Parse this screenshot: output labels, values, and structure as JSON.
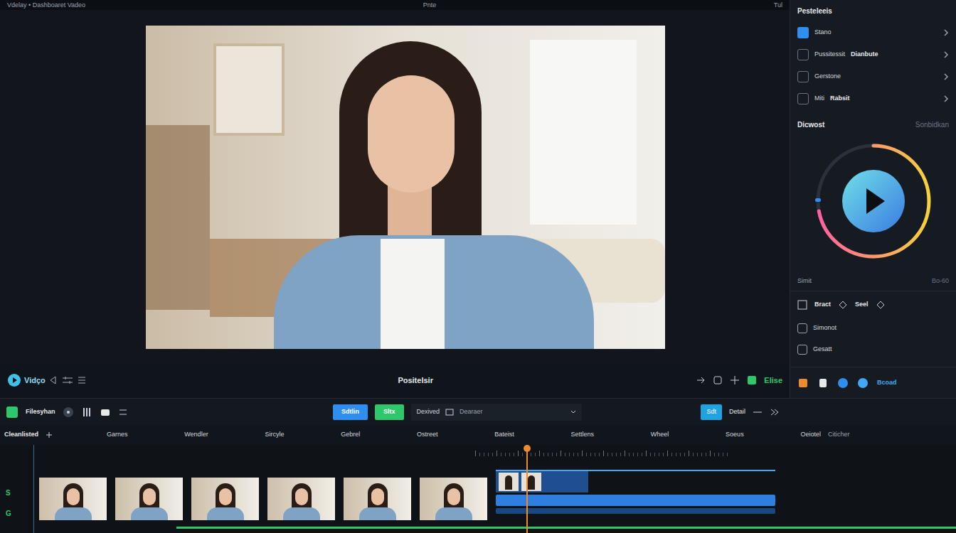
{
  "top_bar": {
    "title": "Vdelay • Dashboaret Vadeo",
    "center": "Pnte",
    "right": "Tul"
  },
  "right_panel": {
    "title": "Pesteleeis",
    "rows": [
      {
        "label": "Stano",
        "value": "",
        "selected": true
      },
      {
        "label": "Pussitessit",
        "value": "Dianbute",
        "selected": false
      },
      {
        "label": "Gerstone",
        "value": "",
        "selected": false
      },
      {
        "label": "Miti",
        "value": "Rabsit",
        "selected": false
      }
    ],
    "section": {
      "title": "Dicwost",
      "action": "Sonbidkan"
    },
    "ring_level": 0.72,
    "under": {
      "label": "Simit",
      "value": "Bo-60"
    },
    "tabs": [
      {
        "label": "Bract"
      },
      {
        "label": "Seel"
      }
    ],
    "options": [
      {
        "label": "Simonot"
      },
      {
        "label": "Gesatt"
      }
    ],
    "footer_action": "Bcoad"
  },
  "preview_bar": {
    "logo": "Vidço",
    "title": "Positelsir",
    "action": "Elise"
  },
  "toolbar": {
    "left": "Filesyhan",
    "buttons": [
      {
        "label": "Sdtlin",
        "color": "#2f8ff0"
      },
      {
        "label": "Sltx",
        "color": "#2fc76b"
      }
    ],
    "field": "Dexived",
    "dropdown": "Dearaer",
    "right_button": "Sdt",
    "right_label": "Detail"
  },
  "timeline": {
    "label": "Cleanlisted",
    "columns": [
      "Garnes",
      "Wendler",
      "Sircyle",
      "Gebrel",
      "Ostreet",
      "Bateist",
      "Settlens",
      "Wheel",
      "Soeus",
      "Oeiotel"
    ],
    "end": "Citicher",
    "playhead": 0.534,
    "track_labels": [
      "S",
      "G"
    ]
  }
}
